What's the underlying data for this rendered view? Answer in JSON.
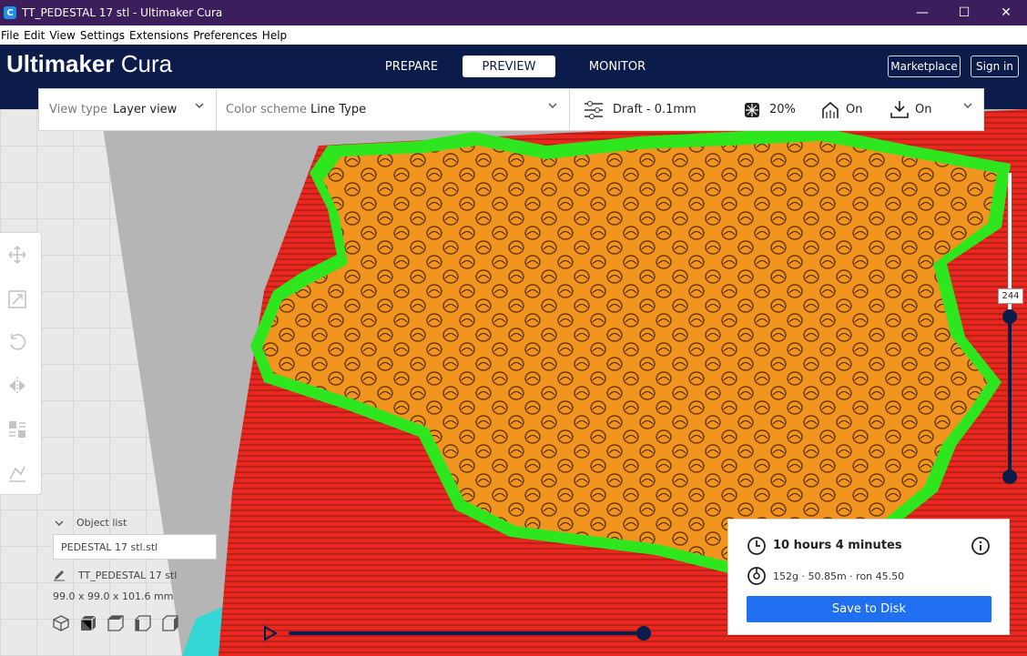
{
  "window": {
    "title": "TT_PEDESTAL 17 stl - Ultimaker Cura",
    "app_icon_glyph": "C",
    "controls": {
      "minimize": "—",
      "maximize": "☐",
      "close": "✕"
    }
  },
  "menu": [
    "File",
    "Edit",
    "View",
    "Settings",
    "Extensions",
    "Preferences",
    "Help"
  ],
  "header": {
    "brand_bold": "Ultimaker",
    "brand_light": "Cura",
    "tabs": [
      {
        "label": "PREPARE",
        "active": false
      },
      {
        "label": "PREVIEW",
        "active": true
      },
      {
        "label": "MONITOR",
        "active": false
      }
    ],
    "marketplace_label": "Marketplace",
    "signin_label": "Sign in"
  },
  "settings_bar": {
    "view_type_label": "View type",
    "view_type_value": "Layer view",
    "color_scheme_label": "Color scheme",
    "color_scheme_value": "Line Type",
    "profile": "Draft - 0.1mm",
    "infill": "20%",
    "support": "On",
    "adhesion": "On"
  },
  "object_list": {
    "header": "Object list",
    "item": "PEDESTAL 17 stl.stl",
    "name": "TT_PEDESTAL 17 stl",
    "dimensions": "99.0 x 99.0 x 101.6 mm"
  },
  "print_info": {
    "time": "10 hours 4 minutes",
    "material": "152g · 50.85m · ron 45.50",
    "save_label": "Save to Disk"
  },
  "layer_slider": {
    "current_layer": "244"
  },
  "colors": {
    "header_bg": "#0b1c4a",
    "titlebar_bg": "#3c1e5c",
    "accent_blue": "#1f6ff0",
    "wall_red": "#e8271f",
    "skin_orange": "#f2951f",
    "inner_wall_green": "#2ee61e",
    "support_cyan": "#35d6d6"
  }
}
